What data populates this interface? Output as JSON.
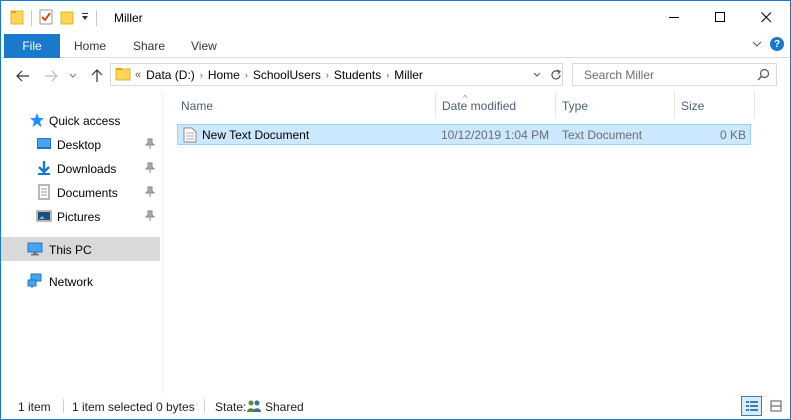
{
  "window": {
    "title": "Miller"
  },
  "ribbon": {
    "tabs": [
      "File",
      "Home",
      "Share",
      "View"
    ]
  },
  "address": {
    "prefix": "«",
    "crumbs": [
      "Data (D:)",
      "Home",
      "SchoolUsers",
      "Students",
      "Miller"
    ]
  },
  "search": {
    "placeholder": "Search Miller"
  },
  "sidebar": {
    "items": [
      {
        "label": "Quick access",
        "icon": "star-icon"
      },
      {
        "label": "Desktop",
        "icon": "desktop-folder-icon",
        "pinned": true
      },
      {
        "label": "Downloads",
        "icon": "download-arrow-icon",
        "pinned": true
      },
      {
        "label": "Documents",
        "icon": "document-icon",
        "pinned": true
      },
      {
        "label": "Pictures",
        "icon": "pictures-icon",
        "pinned": true
      },
      {
        "label": "This PC",
        "icon": "computer-icon",
        "selected": true
      },
      {
        "label": "Network",
        "icon": "network-icon"
      }
    ]
  },
  "columns": {
    "name": "Name",
    "date": "Date modified",
    "type": "Type",
    "size": "Size"
  },
  "files": [
    {
      "name": "New Text Document",
      "date": "10/12/2019 1:04 PM",
      "type": "Text Document",
      "size": "0 KB",
      "icon": "text-file-icon",
      "selected": true
    }
  ],
  "status": {
    "count": "1 item",
    "selected": "1 item selected",
    "size": "0 bytes",
    "state_label": "State:",
    "state_value": "Shared"
  },
  "colors": {
    "accent": "#1979ca",
    "selection": "#cce8ff",
    "folder": "#ffd45a"
  }
}
